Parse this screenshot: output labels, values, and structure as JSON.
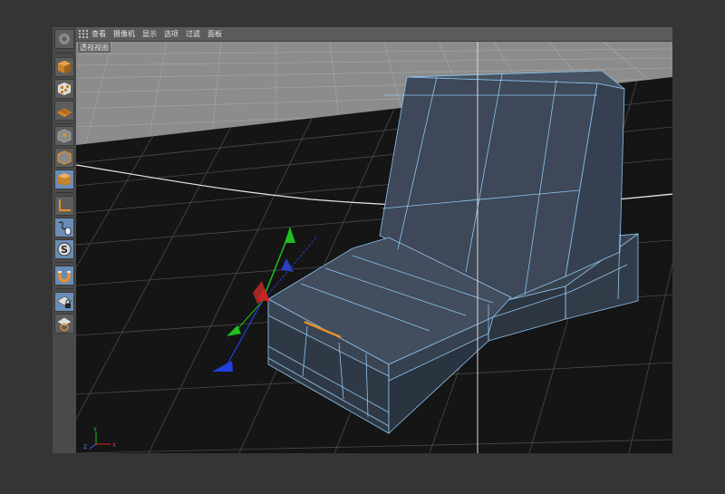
{
  "menubar": {
    "items": [
      {
        "id": "view",
        "label": "查看"
      },
      {
        "id": "camera",
        "label": "摄像机"
      },
      {
        "id": "display",
        "label": "显示"
      },
      {
        "id": "options",
        "label": "选项"
      },
      {
        "id": "filter",
        "label": "过滤"
      },
      {
        "id": "panel",
        "label": "面板"
      }
    ]
  },
  "viewport": {
    "label": "透视视图",
    "axis": {
      "x": "X",
      "y": "Y",
      "z": "Z"
    }
  },
  "toolbar": {
    "tools": [
      {
        "name": "model-mode-icon",
        "active": false
      },
      {
        "name": "texture-mode-icon",
        "active": false
      },
      {
        "name": "workplane-mode-icon",
        "active": false
      },
      {
        "name": "point-mode-icon",
        "active": false
      },
      {
        "name": "edge-mode-icon",
        "active": false
      },
      {
        "name": "polygon-mode-icon",
        "active": true
      },
      {
        "name": "axis-enable-icon",
        "active": false
      },
      {
        "name": "tweak-mode-icon",
        "active": false
      },
      {
        "name": "snap-icon",
        "active": false
      },
      {
        "name": "magnet-icon",
        "active": false
      },
      {
        "name": "lock-workplane-icon",
        "active": false
      },
      {
        "name": "planar-workplane-icon",
        "active": false
      }
    ]
  },
  "colors": {
    "accent": "#e8902a",
    "active_tool": "#6a8db8",
    "mesh_face": "#3f4a5a",
    "mesh_edge": "#8ec6f0",
    "gizmo_x": "#e02020",
    "gizmo_y": "#20c020",
    "gizmo_z": "#2040e0"
  }
}
